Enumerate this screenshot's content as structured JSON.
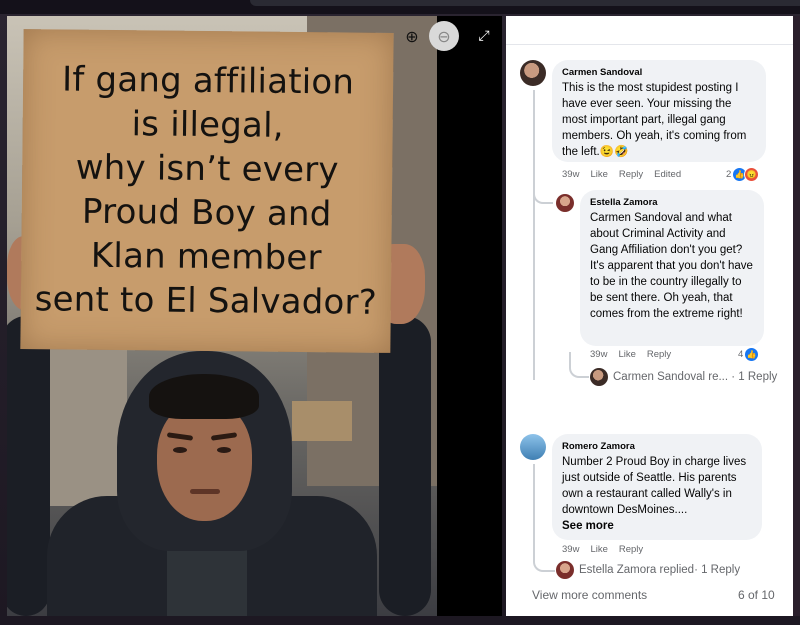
{
  "viewer": {
    "sign_lines": [
      "If gang affiliation",
      "is illegal,",
      "why isn’t every",
      "Proud Boy and",
      "Klan member",
      "sent to El Salvador?"
    ],
    "tools": {
      "zoom_in": "⊕",
      "zoom_out": "⊖",
      "fullscreen": "⤢"
    }
  },
  "comments": [
    {
      "author": "Carmen Sandoval",
      "text": "This is the most stupidest posting I have ever seen. Your missing the most important part, illegal gang members. Oh yeah, it's coming from the left.😉🤣",
      "meta": {
        "time": "39w",
        "like": "Like",
        "reply": "Reply",
        "edited": "Edited"
      },
      "reaction_count": "2",
      "replies": [
        {
          "author": "Estella Zamora",
          "mention": "Carmen Sandoval",
          "text": " and what about Criminal Activity and Gang Affiliation don't you get? It's apparent that you don't have to be in the country illegally to be sent there. Oh yeah, that comes from the extreme right!",
          "meta": {
            "time": "39w",
            "like": "Like",
            "reply": "Reply"
          },
          "reaction_count": "4"
        }
      ],
      "reply_summary": {
        "name": "Carmen Sandoval re...",
        "count": "· 1 Reply"
      }
    },
    {
      "author": "Romero Zamora",
      "text": "Number 2 Proud Boy in charge lives just outside of Seattle. His parents own a restaurant called Wally's in downtown DesMoines....",
      "see_more": "See more",
      "meta": {
        "time": "39w",
        "like": "Like",
        "reply": "Reply"
      },
      "reply_summary": {
        "name": "Estella Zamora replied",
        "count": " · 1 Reply"
      }
    }
  ],
  "footer": {
    "view_more": "View more comments",
    "page_count": "6 of 10"
  },
  "colors": {
    "accent": "#1877f2",
    "bubble": "#f0f2f5",
    "muted": "#65676b"
  }
}
